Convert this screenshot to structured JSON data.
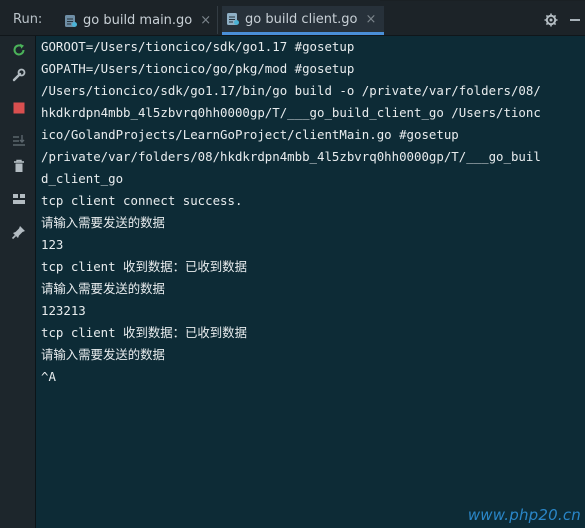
{
  "header": {
    "run_label": "Run:",
    "tabs": [
      {
        "label": "go build main.go",
        "active": false,
        "icon": "go-file-icon"
      },
      {
        "label": "go build client.go",
        "active": true,
        "icon": "go-file-icon"
      }
    ],
    "close_glyph": "×"
  },
  "toolbar": {
    "items": [
      "rerun-icon",
      "wrench-icon",
      "stop-icon",
      "sort-icon",
      "trash-icon",
      "layout-icon",
      "pin-icon"
    ]
  },
  "console": {
    "lines": [
      "GOROOT=/Users/tioncico/sdk/go1.17 #gosetup",
      "GOPATH=/Users/tioncico/go/pkg/mod #gosetup",
      "/Users/tioncico/sdk/go1.17/bin/go build -o /private/var/folders/08/",
      "hkdkrdpn4mbb_4l5zbvrq0hh0000gp/T/___go_build_client_go /Users/tionc",
      "ico/GolandProjects/LearnGoProject/clientMain.go #gosetup",
      "/private/var/folders/08/hkdkrdpn4mbb_4l5zbvrq0hh0000gp/T/___go_buil",
      "d_client_go",
      "tcp client connect success.",
      "请输入需要发送的数据",
      "123",
      "tcp client 收到数据：已收到数据",
      "请输入需要发送的数据",
      "123213",
      "tcp client 收到数据：已收到数据",
      "请输入需要发送的数据",
      "^A"
    ]
  },
  "watermark": "www.php20.cn",
  "colors": {
    "console_bg": "#0d2b36",
    "text": "#e8ecee",
    "accent": "#4a8fd8",
    "stop": "#d94f4f",
    "rerun": "#4bb35a"
  }
}
